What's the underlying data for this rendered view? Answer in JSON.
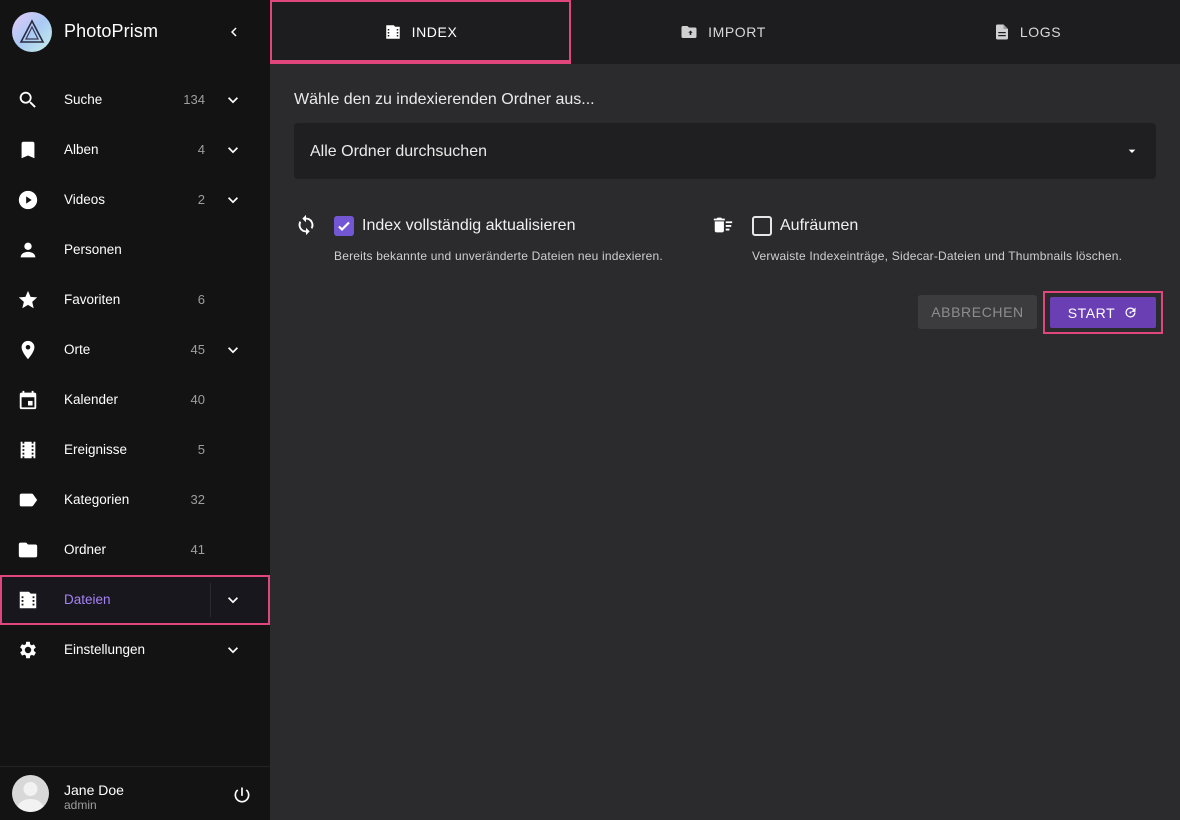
{
  "app": {
    "name": "PhotoPrism"
  },
  "sidebar": {
    "items": [
      {
        "label": "Suche",
        "count": "134",
        "icon": "search-icon"
      },
      {
        "label": "Alben",
        "count": "4",
        "icon": "bookmark-icon"
      },
      {
        "label": "Videos",
        "count": "2",
        "icon": "play-circle-icon"
      },
      {
        "label": "Personen",
        "count": "",
        "icon": "person-icon"
      },
      {
        "label": "Favoriten",
        "count": "6",
        "icon": "star-icon"
      },
      {
        "label": "Orte",
        "count": "45",
        "icon": "map-pin-icon"
      },
      {
        "label": "Kalender",
        "count": "40",
        "icon": "calendar-icon"
      },
      {
        "label": "Ereignisse",
        "count": "5",
        "icon": "film-icon"
      },
      {
        "label": "Kategorien",
        "count": "32",
        "icon": "label-icon"
      },
      {
        "label": "Ordner",
        "count": "41",
        "icon": "folder-icon"
      },
      {
        "label": "Dateien",
        "count": "",
        "icon": "folder-film-icon"
      },
      {
        "label": "Einstellungen",
        "count": "",
        "icon": "gear-icon"
      }
    ]
  },
  "user": {
    "name": "Jane Doe",
    "role": "admin"
  },
  "tabs": [
    {
      "label": "INDEX"
    },
    {
      "label": "IMPORT"
    },
    {
      "label": "LOGS"
    }
  ],
  "index": {
    "prompt": "Wähle den zu indexierenden Ordner aus...",
    "folder_selected": "Alle Ordner durchsuchen",
    "option_rescan": {
      "label": "Index vollständig aktualisieren",
      "hint": "Bereits bekannte und unveränderte Dateien neu indexieren.",
      "checked": true
    },
    "option_cleanup": {
      "label": "Aufräumen",
      "hint": "Verwaiste Indexeinträge, Sidecar-Dateien und Thumbnails löschen.",
      "checked": false
    },
    "cancel_label": "ABBRECHEN",
    "start_label": "START"
  },
  "colors": {
    "accent": "#6a3fb4",
    "highlight": "#e0457b",
    "active_text": "#a682f5",
    "checkbox": "#7356d3"
  }
}
